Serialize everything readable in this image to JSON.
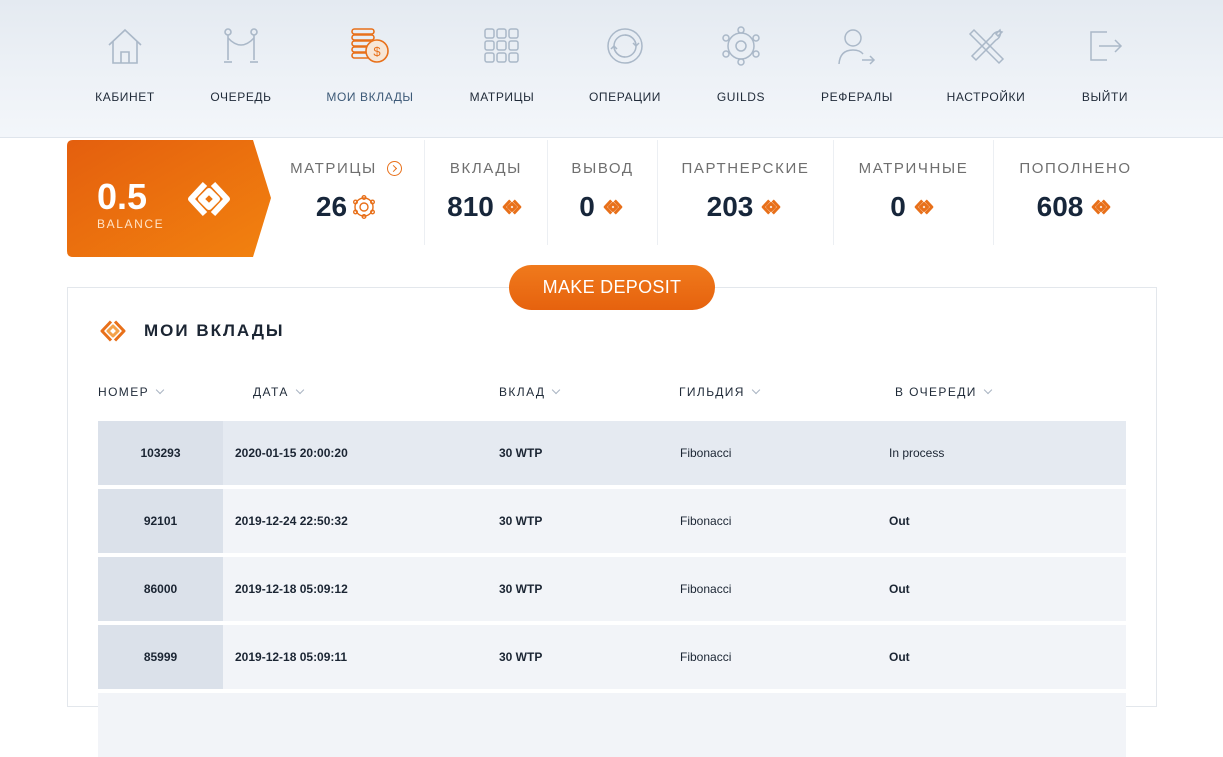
{
  "nav": {
    "items": [
      {
        "label": "КАБИНЕТ",
        "icon": "home-icon"
      },
      {
        "label": "ОЧЕРЕДЬ",
        "icon": "queue-barrier-icon"
      },
      {
        "label": "МОИ ВКЛАДЫ",
        "icon": "coins-icon",
        "active": true
      },
      {
        "label": "МАТРИЦЫ",
        "icon": "grid-icon"
      },
      {
        "label": "ОПЕРАЦИИ",
        "icon": "cycle-icon"
      },
      {
        "label": "GUILDS",
        "icon": "network-icon"
      },
      {
        "label": "РЕФЕРАЛЫ",
        "icon": "user-share-icon"
      },
      {
        "label": "НАСТРОЙКИ",
        "icon": "tools-icon"
      },
      {
        "label": "ВЫЙТИ",
        "icon": "logout-icon"
      }
    ]
  },
  "balance": {
    "value": "0.5",
    "caption": "BALANCE"
  },
  "stats": [
    {
      "title": "МАТРИЦЫ",
      "value": "26",
      "icon": "matrix-coin-icon",
      "has_arrow": true
    },
    {
      "title": "ВКЛАДЫ",
      "value": "810",
      "icon": "wtp-coin-icon"
    },
    {
      "title": "ВЫВОД",
      "value": "0",
      "icon": "wtp-coin-icon"
    },
    {
      "title": "ПАРТНЕРСКИЕ",
      "value": "203",
      "icon": "wtp-coin-icon"
    },
    {
      "title": "МАТРИЧНЫЕ",
      "value": "0",
      "icon": "wtp-coin-icon"
    },
    {
      "title": "ПОПОЛНЕНО",
      "value": "608",
      "icon": "wtp-coin-icon"
    }
  ],
  "deposit_button": "MAKE DEPOSIT",
  "panel": {
    "title": "МОИ ВКЛАДЫ",
    "columns": [
      "НОМЕР",
      "ДАТА",
      "ВКЛАД",
      "ГИЛЬДИЯ",
      "В ОЧЕРЕДИ"
    ],
    "rows": [
      {
        "id": "103293",
        "date": "2020-01-15 20:00:20",
        "amount": "30 WTP",
        "guild": "Fibonacci",
        "status": "In process"
      },
      {
        "id": "92101",
        "date": "2019-12-24 22:50:32",
        "amount": "30 WTP",
        "guild": "Fibonacci",
        "status": "Out"
      },
      {
        "id": "86000",
        "date": "2019-12-18 05:09:12",
        "amount": "30 WTP",
        "guild": "Fibonacci",
        "status": "Out"
      },
      {
        "id": "85999",
        "date": "2019-12-18 05:09:11",
        "amount": "30 WTP",
        "guild": "Fibonacci",
        "status": "Out"
      }
    ]
  },
  "colors": {
    "accent": "#f07a1c",
    "accent_dark": "#e6620e",
    "nav_bg": "#e9eef4",
    "icon_stroke": "#aab8c8"
  }
}
